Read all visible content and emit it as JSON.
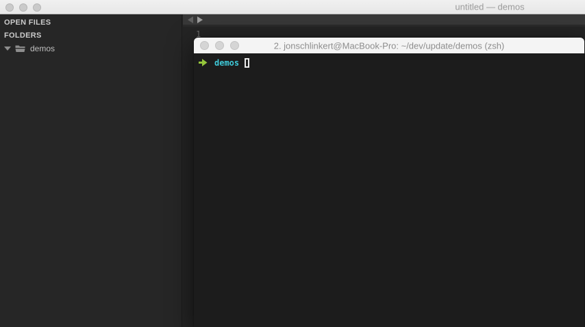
{
  "main_window": {
    "title": "untitled — demos"
  },
  "sidebar": {
    "open_files_label": "OPEN FILES",
    "folders_label": "FOLDERS",
    "folder_name": "demos"
  },
  "editor": {
    "line_number": "1",
    "icons": {
      "tab_scroll_left": "left-triangle",
      "tab_scroll_right": "right-triangle"
    }
  },
  "terminal": {
    "title": "2. jonschlinkert@MacBook-Pro: ~/dev/update/demos (zsh)",
    "prompt_arrow_icon": "➜",
    "prompt_dir": "demos",
    "cursor": "hollow-block"
  },
  "colors": {
    "titlebar_bg": "#ececec",
    "sidebar_bg": "#262626",
    "editor_bg": "#242424",
    "tabbar_bg": "#383838",
    "terminal_bg": "#1c1c1c",
    "terminal_titlebar_bg": "#f4f4f4",
    "prompt_arrow_green": "#95c63b",
    "prompt_dir_cyan": "#3fc9d8"
  }
}
